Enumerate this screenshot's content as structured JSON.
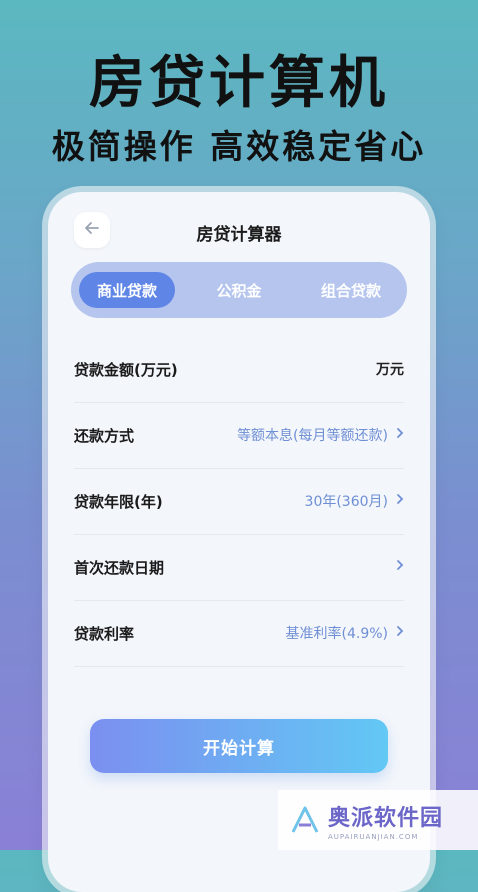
{
  "hero": {
    "title": "房贷计算机",
    "subtitle": "极简操作 高效稳定省心"
  },
  "screen": {
    "title": "房贷计算器",
    "back_icon": "arrow-left-icon"
  },
  "tabs": [
    {
      "label": "商业贷款",
      "active": true
    },
    {
      "label": "公积金",
      "active": false
    },
    {
      "label": "组合贷款",
      "active": false
    }
  ],
  "rows": [
    {
      "label": "贷款金额(万元)",
      "value": "万元"
    },
    {
      "label": "还款方式",
      "value": "等额本息(每月等额还款)"
    },
    {
      "label": "贷款年限(年)",
      "value": "30年(360月)"
    },
    {
      "label": "首次还款日期",
      "value": ""
    },
    {
      "label": "贷款利率",
      "value": "基准利率(4.9%)"
    }
  ],
  "cta": {
    "label": "开始计算"
  },
  "watermark": {
    "main": "奥派软件园",
    "sub": "AUPAIRUANJIAN.COM"
  },
  "colors": {
    "accent": "#5f86e6",
    "value_text": "#6f8fd5",
    "tab_bg": "#b5c5ee"
  }
}
